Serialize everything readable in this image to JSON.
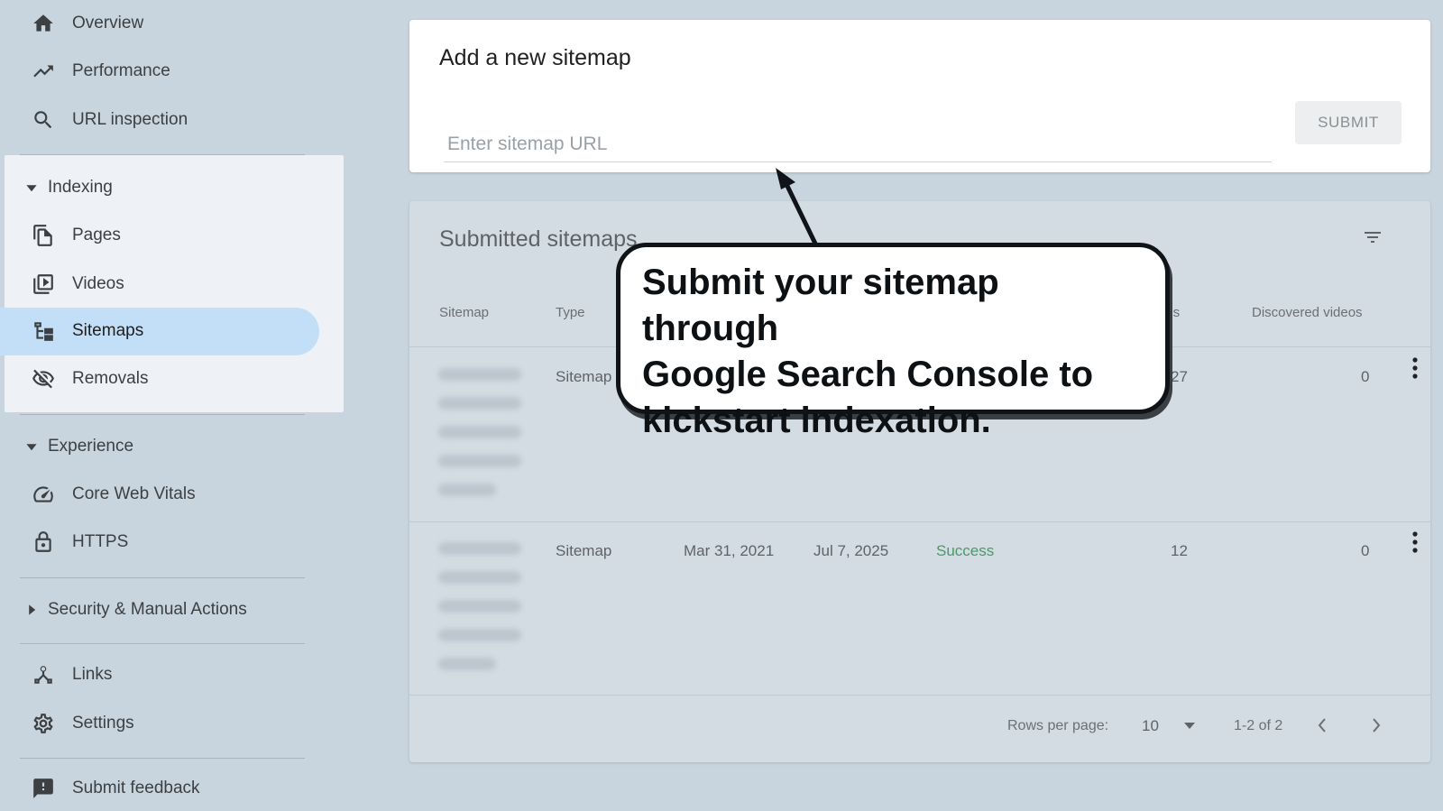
{
  "sidebar": {
    "top_items": [
      {
        "label": "Overview",
        "icon": "home-icon"
      },
      {
        "label": "Performance",
        "icon": "trending-up-icon"
      },
      {
        "label": "URL inspection",
        "icon": "search-icon"
      }
    ],
    "indexing": {
      "header": "Indexing",
      "items": [
        {
          "label": "Pages",
          "icon": "pages-icon"
        },
        {
          "label": "Videos",
          "icon": "video-icon"
        },
        {
          "label": "Sitemaps",
          "icon": "sitemap-icon",
          "active": true
        },
        {
          "label": "Removals",
          "icon": "eye-off-icon"
        }
      ]
    },
    "experience": {
      "header": "Experience",
      "items": [
        {
          "label": "Core Web Vitals",
          "icon": "speedometer-icon"
        },
        {
          "label": "HTTPS",
          "icon": "lock-icon"
        }
      ]
    },
    "security": {
      "header": "Security & Manual Actions"
    },
    "bottom_items": [
      {
        "label": "Links",
        "icon": "links-icon"
      },
      {
        "label": "Settings",
        "icon": "gear-icon"
      }
    ],
    "feedback": {
      "label": "Submit feedback",
      "icon": "feedback-icon"
    }
  },
  "add_sitemap": {
    "title": "Add a new sitemap",
    "input_placeholder": "Enter sitemap URL",
    "input_value": "",
    "submit_label": "SUBMIT"
  },
  "submitted": {
    "title": "Submitted sitemaps",
    "columns": {
      "sitemap": "Sitemap",
      "type": "Type",
      "pages": "ges",
      "videos": "Discovered videos"
    },
    "rows": [
      {
        "type": "Sitemap",
        "submitted": "",
        "last_read": "",
        "status": "",
        "pages": "27",
        "videos": "0"
      },
      {
        "type": "Sitemap",
        "submitted": "Mar 31, 2021",
        "last_read": "Jul 7, 2025",
        "status": "Success",
        "pages": "12",
        "videos": "0"
      }
    ],
    "footer": {
      "rows_per_page_label": "Rows per page:",
      "rows_per_page_value": "10",
      "range": "1-2 of 2"
    }
  },
  "callout": {
    "line1": "Submit your sitemap through",
    "line2": "Google Search Console to",
    "line3": "kickstart indexation."
  },
  "colors": {
    "background": "#c9d5de",
    "active_pill": "#c2dff7",
    "success": "#4a9a66",
    "callout_border": "#101418"
  }
}
